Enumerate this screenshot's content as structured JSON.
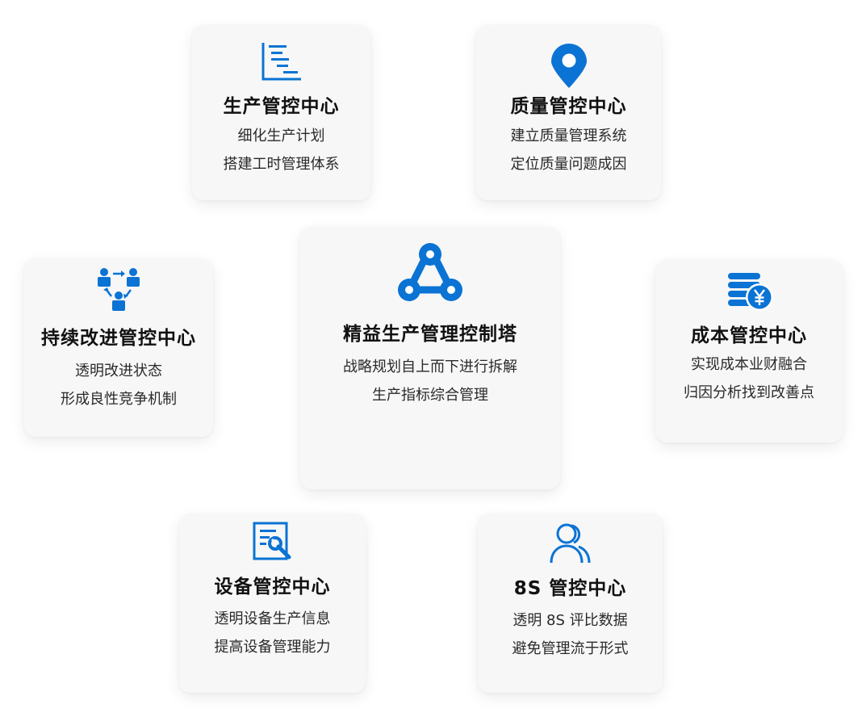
{
  "brand_color": "#0a73d4",
  "cards": {
    "production": {
      "icon": "gantt-chart-icon",
      "title": "生产管控中心",
      "lines": [
        "细化生产计划",
        "搭建工时管理体系"
      ]
    },
    "quality": {
      "icon": "location-pin-icon",
      "title": "质量管控中心",
      "lines": [
        "建立质量管理系统",
        "定位质量问题成因"
      ]
    },
    "improve": {
      "icon": "team-cycle-icon",
      "title": "持续改进管控中心",
      "lines": [
        "透明改进状态",
        "形成良性竞争机制"
      ]
    },
    "center": {
      "icon": "network-hub-icon",
      "title": "精益生产管理控制塔",
      "lines": [
        "战略规划自上而下进行拆解",
        "生产指标综合管理"
      ]
    },
    "cost": {
      "icon": "coin-stack-yuan-icon",
      "title": "成本管控中心",
      "lines": [
        "实现成本业财融合",
        "归因分析找到改善点"
      ]
    },
    "equipment": {
      "icon": "document-wrench-icon",
      "title": "设备管控中心",
      "lines": [
        "透明设备生产信息",
        "提高设备管理能力"
      ]
    },
    "eight_s": {
      "icon": "users-icon",
      "title": "8S 管控中心",
      "lines": [
        "透明 8S 评比数据",
        "避免管理流于形式"
      ]
    }
  }
}
